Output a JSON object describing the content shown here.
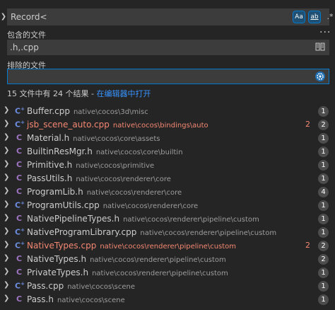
{
  "search": {
    "value": "Record<",
    "options": {
      "case": "Aa",
      "word": "ab",
      "regex": ".*"
    }
  },
  "include": {
    "label": "包含的文件",
    "value": ".h,.cpp"
  },
  "exclude": {
    "label": "排除的文件",
    "value": ""
  },
  "summary": {
    "text": "15 文件中有 24 个结果 - ",
    "link": "在编辑器中打开"
  },
  "results": [
    {
      "icon": "C",
      "type": "cpp",
      "name": "Buffer.cpp",
      "path": "native\\cocos\\3d\\misc",
      "count": "1",
      "errors": "",
      "error": false
    },
    {
      "icon": "C",
      "type": "cpp",
      "name": "jsb_scene_auto.cpp",
      "path": "native\\cocos\\bindings\\auto",
      "count": "2",
      "errors": "2",
      "error": true
    },
    {
      "icon": "C",
      "type": "h",
      "name": "Material.h",
      "path": "native\\cocos\\core\\assets",
      "count": "1",
      "errors": "",
      "error": false
    },
    {
      "icon": "C",
      "type": "h",
      "name": "BuiltinResMgr.h",
      "path": "native\\cocos\\core\\builtin",
      "count": "1",
      "errors": "",
      "error": false
    },
    {
      "icon": "C",
      "type": "h",
      "name": "Primitive.h",
      "path": "native\\cocos\\primitive",
      "count": "1",
      "errors": "",
      "error": false
    },
    {
      "icon": "C",
      "type": "h",
      "name": "PassUtils.h",
      "path": "native\\cocos\\renderer\\core",
      "count": "1",
      "errors": "",
      "error": false
    },
    {
      "icon": "C",
      "type": "h",
      "name": "ProgramLib.h",
      "path": "native\\cocos\\renderer\\core",
      "count": "4",
      "errors": "",
      "error": false
    },
    {
      "icon": "C",
      "type": "cpp",
      "name": "ProgramUtils.cpp",
      "path": "native\\cocos\\renderer\\core",
      "count": "1",
      "errors": "",
      "error": false
    },
    {
      "icon": "C",
      "type": "h",
      "name": "NativePipelineTypes.h",
      "path": "native\\cocos\\renderer\\pipeline\\custom",
      "count": "1",
      "errors": "",
      "error": false
    },
    {
      "icon": "C",
      "type": "cpp",
      "name": "NativeProgramLibrary.cpp",
      "path": "native\\cocos\\renderer\\pipeline\\custom",
      "count": "1",
      "errors": "",
      "error": false
    },
    {
      "icon": "C",
      "type": "cpp",
      "name": "NativeTypes.cpp",
      "path": "native\\cocos\\renderer\\pipeline\\custom",
      "count": "2",
      "errors": "2",
      "error": true
    },
    {
      "icon": "C",
      "type": "h",
      "name": "NativeTypes.h",
      "path": "native\\cocos\\renderer\\pipeline\\custom",
      "count": "2",
      "errors": "",
      "error": false
    },
    {
      "icon": "C",
      "type": "h",
      "name": "PrivateTypes.h",
      "path": "native\\cocos\\renderer\\pipeline\\custom",
      "count": "1",
      "errors": "",
      "error": false
    },
    {
      "icon": "C",
      "type": "cpp",
      "name": "Pass.cpp",
      "path": "native\\cocos\\scene",
      "count": "1",
      "errors": "",
      "error": false
    },
    {
      "icon": "C",
      "type": "h",
      "name": "Pass.h",
      "path": "native\\cocos\\scene",
      "count": "1",
      "errors": "",
      "error": false
    }
  ]
}
